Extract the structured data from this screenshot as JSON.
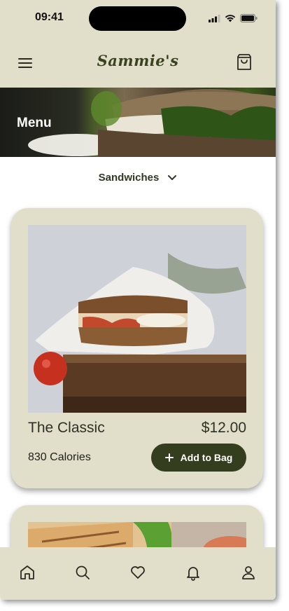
{
  "status_bar": {
    "time": "09:41"
  },
  "header": {
    "brand": "Sammie's",
    "menu_icon": "hamburger-menu-icon",
    "bag_icon": "shopping-bag-icon"
  },
  "hero": {
    "title": "Menu"
  },
  "category": {
    "label": "Sandwiches",
    "icon": "chevron-down-icon"
  },
  "products": [
    {
      "name": "The Classic",
      "price": "$12.00",
      "calories": "830 Calories",
      "button_label": "Add to Bag"
    }
  ],
  "tabbar": {
    "items": [
      {
        "icon": "home-icon"
      },
      {
        "icon": "search-icon"
      },
      {
        "icon": "heart-icon"
      },
      {
        "icon": "bell-icon"
      },
      {
        "icon": "profile-icon"
      }
    ]
  },
  "colors": {
    "accent": "#353d1f",
    "beige": "#e1dfc9",
    "text": "#2d3126"
  }
}
